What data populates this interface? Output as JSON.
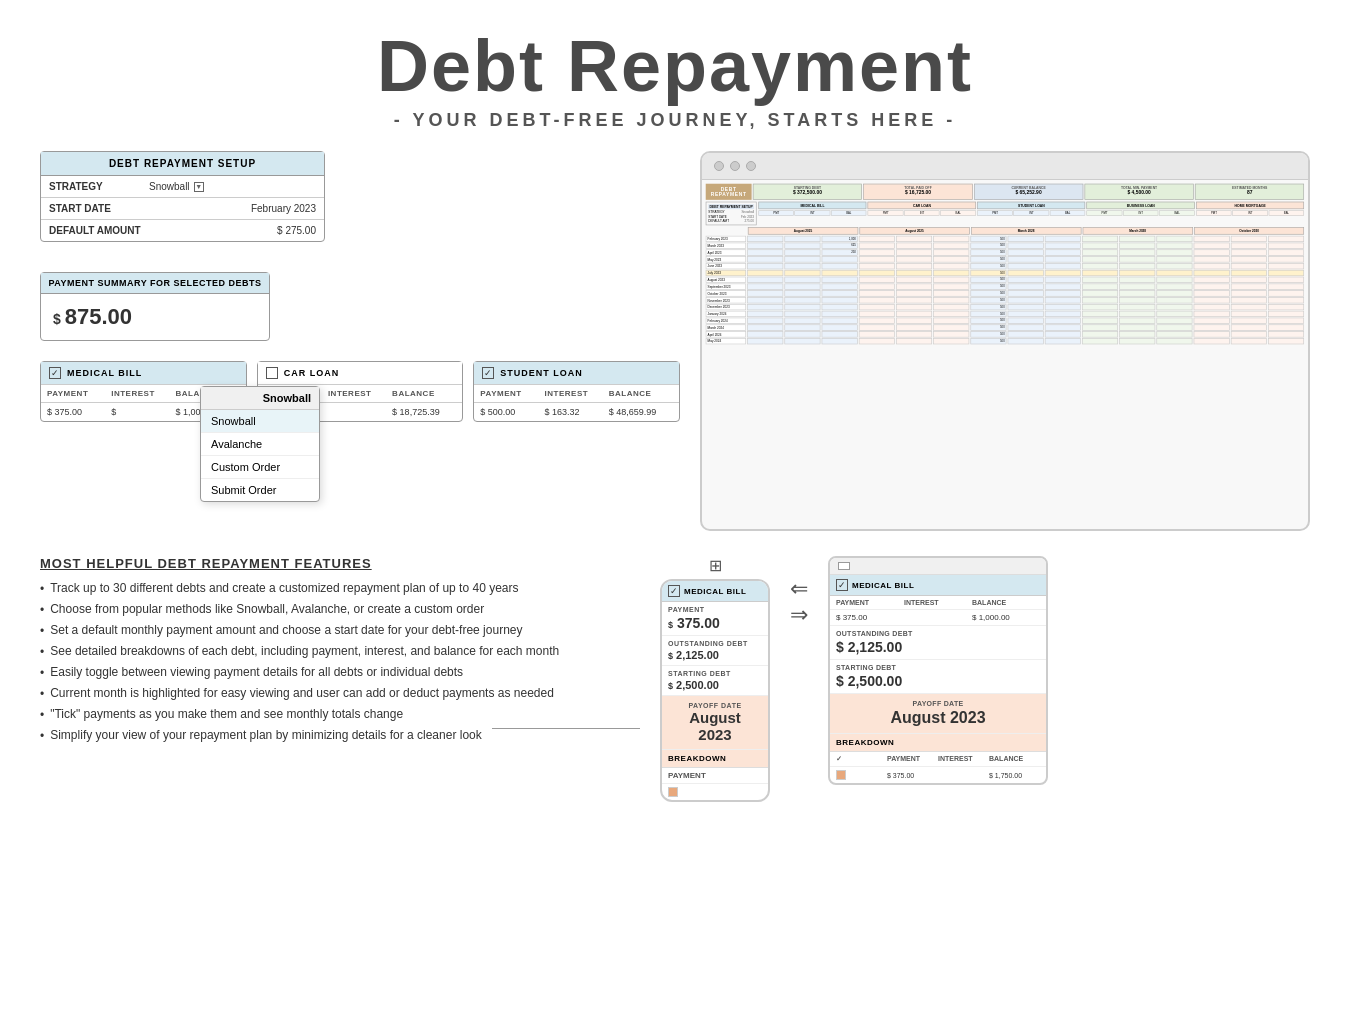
{
  "header": {
    "title": "Debt Repayment",
    "subtitle": "- YOUR DEBT-FREE JOURNEY, STARTS HERE -"
  },
  "setup_box": {
    "title": "DEBT REPAYMENT SETUP",
    "rows": [
      {
        "label": "STRATEGY",
        "value": "Snowball"
      },
      {
        "label": "START DATE",
        "value": "February 2023"
      },
      {
        "label": "DEFAULT AMOUNT",
        "value": "$ 275.00"
      }
    ]
  },
  "dropdown": {
    "header": "Snowball",
    "items": [
      "Snowball",
      "Avalanche",
      "Custom Order",
      "Submit Order"
    ]
  },
  "payment_summary": {
    "title": "PAYMENT SUMMARY FOR SELECTED DEBTS",
    "amount": "875.00",
    "currency": "$"
  },
  "debt_cards": [
    {
      "id": "medical",
      "title": "MEDICAL BILL",
      "checked": true,
      "columns": [
        "PAYMENT",
        "INTEREST",
        "BALANCE"
      ],
      "values": [
        "$ 375.00",
        "$",
        "$ 1,000.00"
      ]
    },
    {
      "id": "car",
      "title": "CAR LOAN",
      "checked": false,
      "columns": [
        "PAYMENT",
        "INTEREST",
        "BALANCE"
      ],
      "values": [
        "$",
        "",
        "$ 18,725.39"
      ]
    },
    {
      "id": "student",
      "title": "STUDENT LOAN",
      "checked": true,
      "columns": [
        "PAYMENT",
        "INTEREST",
        "BALANCE"
      ],
      "values": [
        "$ 500.00",
        "$ 163.32",
        "$ 48,659.99"
      ]
    }
  ],
  "spreadsheet": {
    "summary_cards": [
      {
        "label": "STARTING DEBT",
        "value": "$ 372,500.00",
        "style": "green"
      },
      {
        "label": "TOTAL PAID OFF",
        "value": "$ 16,725.00",
        "style": "pink"
      },
      {
        "label": "CURRENT BALANCE",
        "value": "$ 65,252.90",
        "style": "blue"
      },
      {
        "label": "TOTAL MIN. PAYMENT",
        "value": "$ 4,500.00",
        "style": "green"
      },
      {
        "label": "ESTIMATED MONTHS",
        "value": "87",
        "style": "green"
      }
    ],
    "payoff_dates": [
      "August 2025",
      "August 2025",
      "March 2028",
      "March 2028",
      "October 2030"
    ]
  },
  "features": {
    "title": "MOST HELPFUL DEBT REPAYMENT FEATURES",
    "items": [
      "Track up to 30 different debts and create a customized repayment plan of up to 40 years",
      "Choose from popular methods like Snowball, Avalanche, or create a custom order",
      "Set a default monthly payment amount and choose a start date for your debt-free journey",
      "See detailed breakdowns of each debt, including payment, interest, and balance for each month",
      "Easily toggle between viewing payment details for all debts or individual debts",
      "Current month is highlighted for easy viewing and user can add or deduct payments as needed",
      "\"Tick\" payments as you make them and see monthly totals change",
      "Simplify your view of your repayment plan by minimizing details for a cleaner look"
    ]
  },
  "mobile_preview": {
    "title": "MEDICAL BILL",
    "sections": [
      {
        "label": "PAYMENT",
        "value": "375.00",
        "currency": "$"
      },
      {
        "label": "OUTSTANDING DEBT",
        "value": "2,125.00",
        "currency": "$"
      },
      {
        "label": "STARTING DEBT",
        "value": "2,500.00",
        "currency": "$"
      },
      {
        "label": "PAYOFF DATE",
        "value": "August 2023",
        "style": "orange"
      }
    ],
    "breakdown_label": "BREAKDOWN",
    "breakdown_items": [
      "PAYMENT"
    ]
  },
  "tablet_preview": {
    "title": "MEDICAL BILL",
    "rows": [
      {
        "labels": [
          "PAYMENT",
          "INTEREST",
          "BALANCE"
        ],
        "values": [
          "375.00",
          "",
          "1,000.00"
        ]
      }
    ],
    "outstanding_label": "OUTSTANDING DEBT",
    "outstanding_value": "2,125.00",
    "starting_label": "STARTING DEBT",
    "starting_value": "2,500.00",
    "payoff_label": "PAYOFF DATE",
    "payoff_value": "August 2023",
    "breakdown_label": "BREAKDOWN",
    "breakdown_cols": [
      "PAYMENT",
      "INTEREST",
      "BALANCE"
    ],
    "breakdown_row": [
      "375.00",
      "",
      "1,750.00"
    ]
  }
}
